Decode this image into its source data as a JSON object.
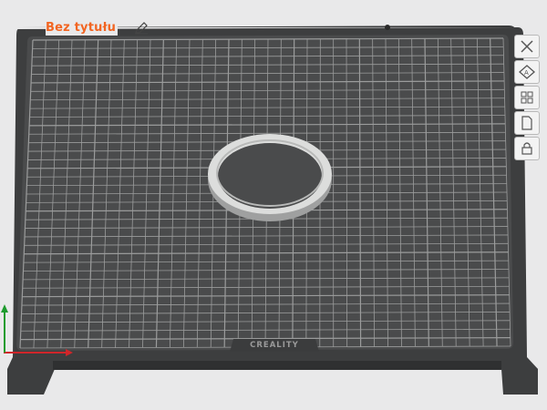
{
  "project": {
    "title": "Bez tytułu"
  },
  "icons": {
    "edit": "pencil-icon",
    "toolbar": [
      "close-view-icon",
      "auto-orient-icon",
      "arrange-icon",
      "plate-settings-icon",
      "lock-icon"
    ]
  },
  "plate": {
    "brand": "CREALITY"
  },
  "colors": {
    "plate": "#4a4b4c",
    "plate_frame": "#3b3c3d",
    "grid": "#9a9b9b",
    "model": "#d8d9d8",
    "title": "#f26522",
    "axis_x": "#d0262a",
    "axis_y": "#1e9b2e",
    "background": "#e9e9ea"
  }
}
